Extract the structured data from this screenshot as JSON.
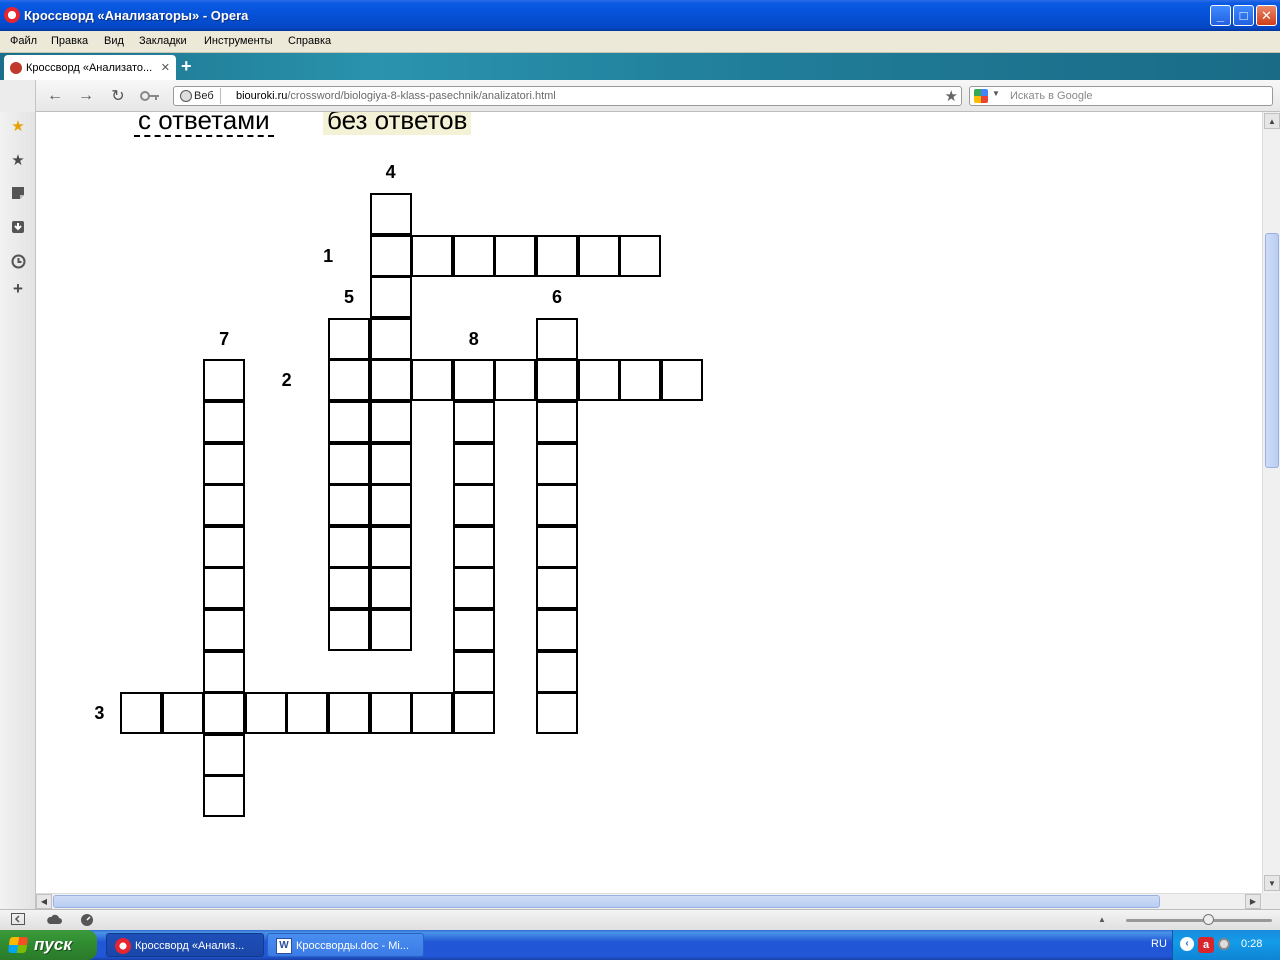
{
  "window": {
    "title": "Кроссворд «Анализаторы» - Opera",
    "minimize": "_",
    "maximize": "□",
    "close": "✕"
  },
  "menu": [
    "Файл",
    "Правка",
    "Вид",
    "Закладки",
    "Инструменты",
    "Справка"
  ],
  "tabs": [
    {
      "label": "Кроссворд «Анализато...",
      "close": "✕"
    }
  ],
  "new_tab": "+",
  "nav": {
    "back": "←",
    "forward": "→",
    "reload": "↻",
    "web_badge": "Веб",
    "url_domain": "biouroki.ru",
    "url_path": "/crossword/biologiya-8-klass-pasechnik/analizatori.html",
    "bookmark_star": "★",
    "search_placeholder": "Искать в Google"
  },
  "page": {
    "with_answers": "с ответами",
    "without_answers": "без ответов",
    "clue_numbers": [
      "1",
      "2",
      "3",
      "4",
      "5",
      "6",
      "7",
      "8"
    ]
  },
  "taskbar": {
    "start": "пуск",
    "windows": [
      {
        "label": "Кроссворд «Анализ..."
      },
      {
        "label": "Кроссворды.doc - Mi..."
      }
    ],
    "language": "RU",
    "clock": "0:28"
  },
  "colors": {
    "titlebar": "#0650d6",
    "tab_strip": "#2a93ad",
    "taskbar": "#2157d7",
    "start_button": "#2f8a2f",
    "highlight": "#f4f2d6"
  }
}
